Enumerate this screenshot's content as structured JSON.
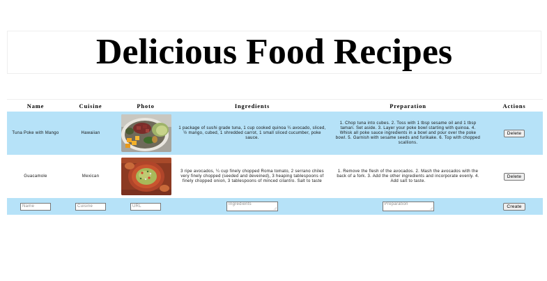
{
  "page": {
    "title": "Delicious Food Recipes"
  },
  "table": {
    "headers": [
      "Name",
      "Cuisine",
      "Photo",
      "Ingredients",
      "Preparation",
      "Actions"
    ],
    "rows": [
      {
        "name": "Tuna Poke with Mango",
        "cuisine": "Hawaiian",
        "photo": "poke-bowl-photo",
        "ingredients": "1 package of sushi grade tuna, 1 cup cooked quinoa ¼ avocado, sliced, ½ mango, cubed, 1 shredded carrot, 1 small sliced cucumber, poke sauce.",
        "preparation": "1. Chop tuna into cubes. 2. Toss with 1 tbsp sesame oil and 1 tbsp tamari. Set aside. 3. Layer your poke bowl starting with quinoa. 4. Whisk all poke sauce ingredients in a bowl and pour over the poke bowl. 5. Garnish with sesame seeds and furikake. 6. Top with chopped scallions.",
        "action_label": "Delete"
      },
      {
        "name": "Guacamole",
        "cuisine": "Mexican",
        "photo": "guacamole-photo",
        "ingredients": "3 ripe avocados, ¼ cup finely chopped Roma tomato, 2 serrano chiles very finely chopped (seeded and deveined), 3 heaping tablespoons of finely chopped onion, 3 tablespoons of minced cilantro. Salt to taste",
        "preparation": "1. Remove the flesh of the avocados. 2. Mash the avocados with the back of a fork. 3. Add the other ingredients and incorporate evenly. 4. Add salt to taste.",
        "action_label": "Delete"
      }
    ],
    "form": {
      "name_placeholder": "Name",
      "cuisine_placeholder": "Cuisine",
      "url_placeholder": "URL",
      "ingredients_placeholder": "Ingredients",
      "preparation_placeholder": "Preparation",
      "create_label": "Create"
    }
  },
  "colors": {
    "row_highlight": "#b6e2f8"
  }
}
